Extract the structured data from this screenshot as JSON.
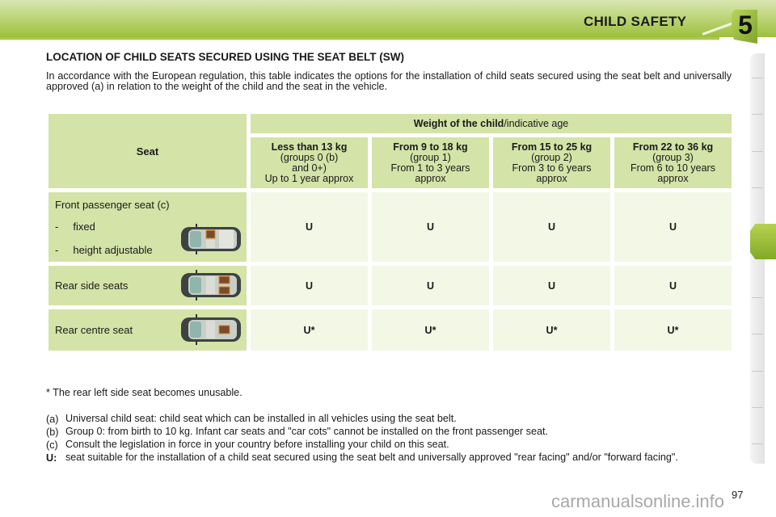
{
  "header": {
    "title": "CHILD SAFETY",
    "chapter": "5",
    "accent_color": "#9dbf3c"
  },
  "section_title": "LOCATION OF CHILD SEATS SECURED USING THE SEAT BELT (SW)",
  "intro": "In accordance with the European regulation, this table indicates the options for the installation of child seats secured using the seat belt and universally approved (a) in relation to the weight of the child and the seat in the vehicle.",
  "table": {
    "seat_header": "Seat",
    "weight_header_bold": "Weight of the child",
    "weight_header_rest": "/indicative age",
    "columns": [
      {
        "title": "Less than 13 kg",
        "lines": [
          "(groups 0 (b)",
          "and 0+)",
          "Up to 1 year approx"
        ]
      },
      {
        "title": "From 9 to 18 kg",
        "lines": [
          "(group 1)",
          "From 1 to 3 years",
          "approx"
        ]
      },
      {
        "title": "From 15 to 25 kg",
        "lines": [
          "(group 2)",
          "From 3 to 6 years",
          "approx"
        ]
      },
      {
        "title": "From 22 to 36 kg",
        "lines": [
          "(group 3)",
          "From 6 to 10 years",
          "approx"
        ]
      }
    ],
    "rows": [
      {
        "label": "Front passenger seat (c)",
        "sub_items": [
          {
            "dash": "-",
            "text": "fixed"
          },
          {
            "dash": "-",
            "text": "height adjustable"
          }
        ],
        "image": "car-top-view-front-passenger",
        "values": [
          "U",
          "U",
          "U",
          "U"
        ]
      },
      {
        "label": "Rear side seats",
        "image": "car-top-view-rear-side",
        "values": [
          "U",
          "U",
          "U",
          "U"
        ]
      },
      {
        "label": "Rear centre seat",
        "image": "car-top-view-rear-centre",
        "values": [
          "U*",
          "U*",
          "U*",
          "U*"
        ]
      }
    ]
  },
  "asterisk_note": "* The rear left side seat becomes unusable.",
  "notes": [
    {
      "key": "(a)",
      "text": "Universal child seat: child seat which can be installed in all vehicles using the seat belt."
    },
    {
      "key": "(b)",
      "text": "Group 0: from birth to 10 kg. Infant car seats and \"car cots\" cannot be installed on the front passenger seat."
    },
    {
      "key": "(c)",
      "text": "Consult the legislation in force in your country before installing your child on this seat."
    },
    {
      "key": "U:",
      "text": "seat suitable for the installation of a child seat secured using the seat belt and universally approved \"rear facing\" and/or \"forward facing\"."
    }
  ],
  "page_number": "97",
  "watermark": "carmanualsonline.info"
}
